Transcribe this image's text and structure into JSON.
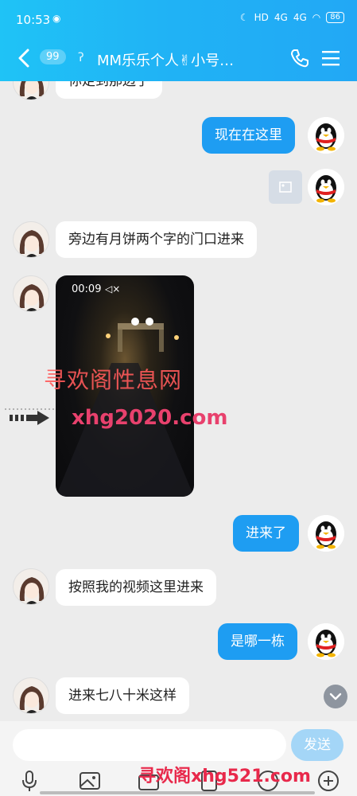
{
  "status": {
    "time": "10:53",
    "battery": "86",
    "net1": "HD",
    "net2": "4G",
    "net3": "4G"
  },
  "header": {
    "unread_count": "99",
    "title": "MM乐乐个人✌小号…"
  },
  "messages": [
    {
      "side": "left",
      "text": "你走到那边了"
    },
    {
      "side": "right",
      "text": "现在在这里"
    },
    {
      "side": "right",
      "type": "image"
    },
    {
      "side": "left",
      "text": "旁边有月饼两个字的门口进来"
    },
    {
      "side": "left",
      "type": "video",
      "duration": "00:09"
    },
    {
      "side": "right",
      "text": "进来了"
    },
    {
      "side": "left",
      "text": "按照我的视频这里进来"
    },
    {
      "side": "right",
      "text": "是哪一栋"
    },
    {
      "side": "left",
      "text": "进来七八十米这样"
    }
  ],
  "watermarks": {
    "wm1": "寻欢阁性息网",
    "wm2": "xhg2020.com",
    "wm3": "寻欢阁xhg521.com"
  },
  "input": {
    "placeholder": "",
    "send_label": "发送"
  },
  "toolbar": {
    "icons": [
      "microphone-icon",
      "image-icon",
      "camera-icon",
      "red-packet-icon",
      "emoji-icon",
      "plus-icon"
    ]
  },
  "colors": {
    "header": "#20b3f5",
    "bubble_right": "#1e9df2",
    "bubble_left": "#ffffff"
  }
}
